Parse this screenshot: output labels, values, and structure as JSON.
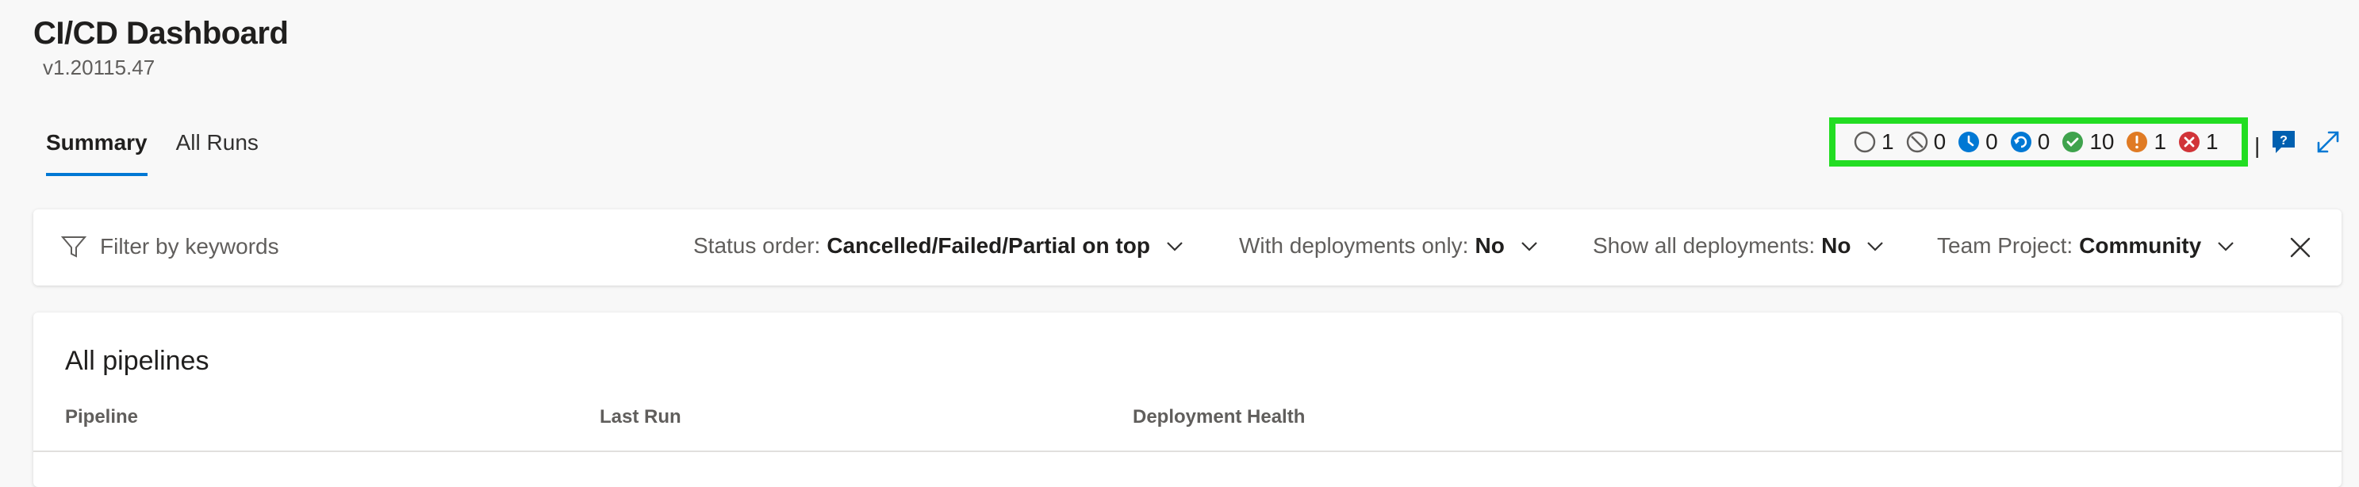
{
  "header": {
    "title": "CI/CD Dashboard",
    "version": "v1.20115.47"
  },
  "tabs": [
    {
      "label": "Summary",
      "active": true
    },
    {
      "label": "All Runs",
      "active": false
    }
  ],
  "status_counts": [
    {
      "icon": "not-started-icon",
      "count": "1"
    },
    {
      "icon": "cancelled-icon",
      "count": "0"
    },
    {
      "icon": "queued-icon",
      "count": "0"
    },
    {
      "icon": "in-progress-icon",
      "count": "0"
    },
    {
      "icon": "succeeded-icon",
      "count": "10"
    },
    {
      "icon": "partially-succeeded-icon",
      "count": "1"
    },
    {
      "icon": "failed-icon",
      "count": "1"
    }
  ],
  "status_separator": "|",
  "filter": {
    "placeholder": "Filter by keywords",
    "status_order": {
      "label": "Status order:",
      "value": "Cancelled/Failed/Partial on top"
    },
    "deployments_only": {
      "label": "With deployments only:",
      "value": "No"
    },
    "show_all": {
      "label": "Show all deployments:",
      "value": "No"
    },
    "team_project": {
      "label": "Team Project:",
      "value": "Community"
    }
  },
  "pipelines": {
    "title": "All pipelines",
    "columns": [
      "Pipeline",
      "Last Run",
      "Deployment Health"
    ]
  },
  "colors": {
    "accent": "#0078d4",
    "success": "#3fa34d",
    "warning": "#e07b24",
    "error": "#d13438",
    "highlight": "#22dd22"
  }
}
